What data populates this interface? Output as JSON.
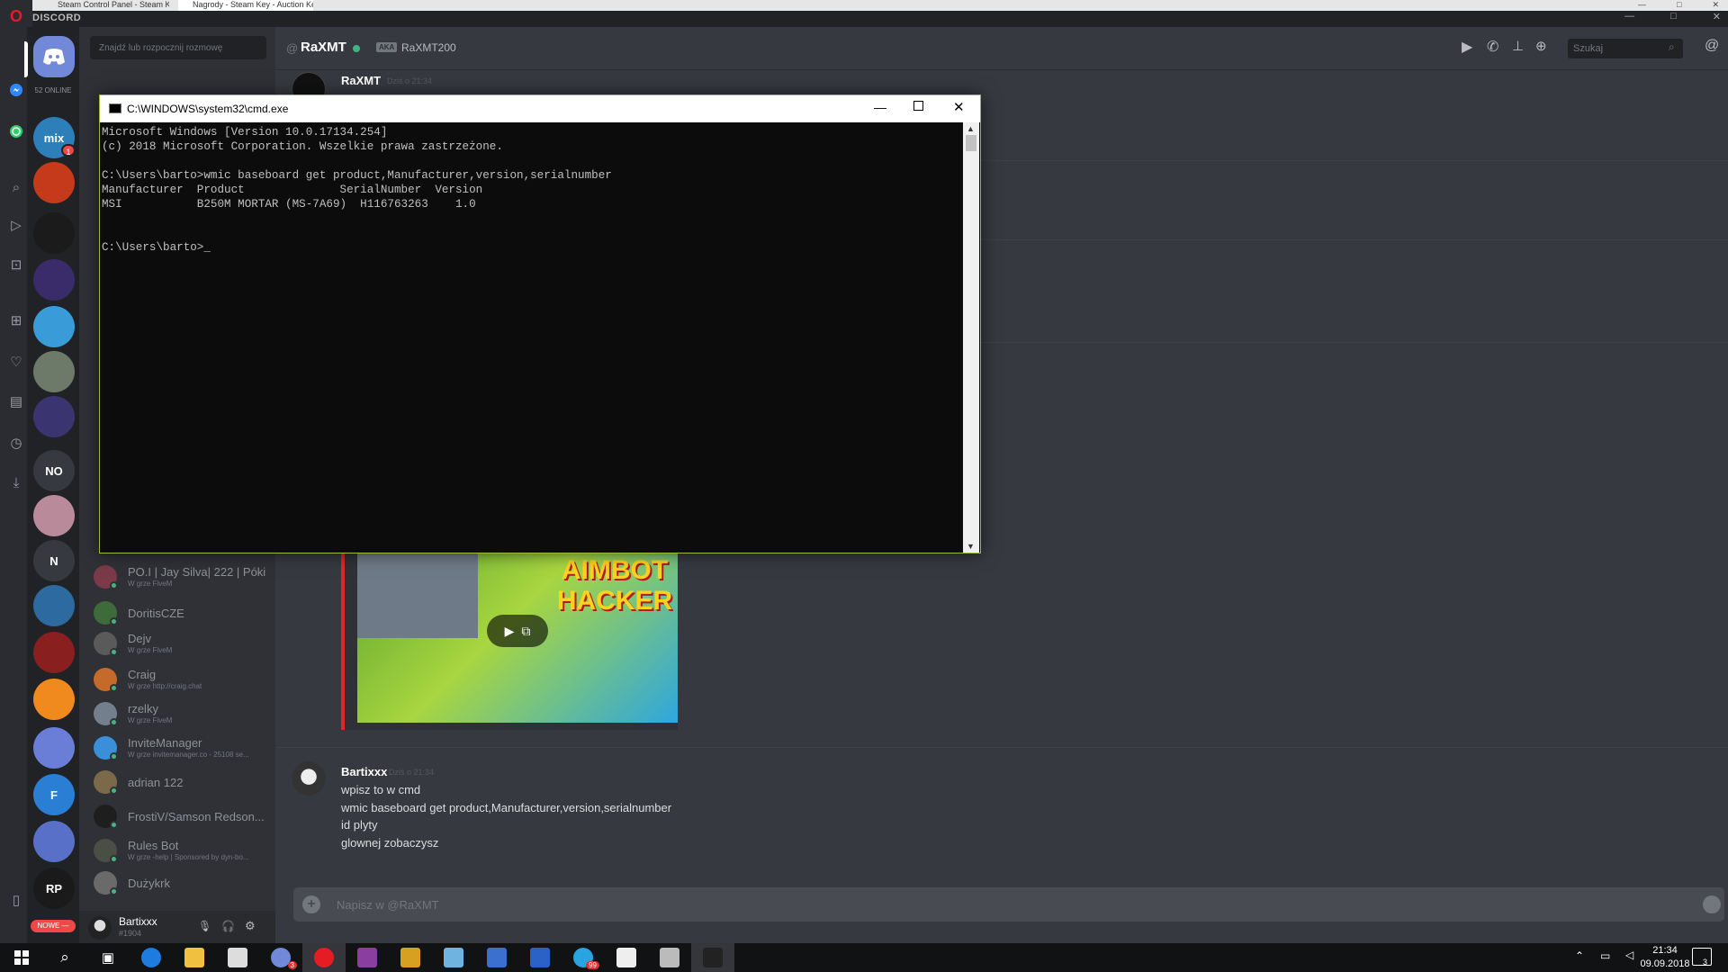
{
  "browser": {
    "tabs": [
      "Steam Control Panel - Steam Key",
      "Nagrody - Steam Key - Auction Ke"
    ],
    "window_controls": [
      "—",
      "□",
      "✕"
    ]
  },
  "discord": {
    "brand": "DISCORD",
    "online_count": "52 ONLINE",
    "window_controls": [
      "—",
      "□",
      "✕"
    ]
  },
  "guilds": [
    {
      "name": "discord-home",
      "label": "",
      "color": "#7289da"
    },
    {
      "name": "mix",
      "label": "mix",
      "color": "#2c7fb8",
      "badge": "1"
    },
    {
      "name": "server-2",
      "label": "",
      "color": "#c43a1a"
    },
    {
      "name": "server-3",
      "label": "",
      "color": "#1b1b1b"
    },
    {
      "name": "server-4",
      "label": "",
      "color": "#3a2b6b"
    },
    {
      "name": "server-5",
      "label": "",
      "color": "#3a9bd9"
    },
    {
      "name": "server-6",
      "label": "",
      "color": "#6d7a6a"
    },
    {
      "name": "server-7",
      "label": "",
      "color": "#3a3570"
    },
    {
      "name": "server-no",
      "label": "NO",
      "color": "#36393f"
    },
    {
      "name": "server-9",
      "label": "",
      "color": "#b88a9a"
    },
    {
      "name": "server-n",
      "label": "N",
      "color": "#36393f"
    },
    {
      "name": "server-11",
      "label": "",
      "color": "#2c6aa0"
    },
    {
      "name": "server-12",
      "label": "",
      "color": "#8a1f1f"
    },
    {
      "name": "server-13",
      "label": "",
      "color": "#f08a1e"
    },
    {
      "name": "server-14",
      "label": "",
      "color": "#6a7ed8"
    },
    {
      "name": "server-15",
      "label": "F",
      "color": "#2a7fd4"
    },
    {
      "name": "server-16",
      "label": "",
      "color": "#5870c8"
    },
    {
      "name": "server-17",
      "label": "RP",
      "color": "#1a1a1a"
    }
  ],
  "new_badge": "NOWE —",
  "dm_search": {
    "placeholder": "Znajdź lub rozpocznij rozmowę"
  },
  "dms": [
    {
      "name": "PO.I | Jay Silva| 222 | Póki",
      "sub": "W grze FiveM",
      "color": "#7a3a4a"
    },
    {
      "name": "DoritisCZE",
      "sub": "",
      "color": "#3f6b3a"
    },
    {
      "name": "Dejv",
      "sub": "W grze FiveM",
      "color": "#5a5a5a"
    },
    {
      "name": "Craig",
      "sub": "W grze http://craig.chat",
      "color": "#c46a2a"
    },
    {
      "name": "rzelky",
      "sub": "W grze FiveM",
      "color": "#747f8d"
    },
    {
      "name": "InviteManager",
      "sub": "W grze invitemanager.co - 25108 se...",
      "color": "#3b8fd8"
    },
    {
      "name": "adrian 122",
      "sub": "",
      "color": "#7a6a4a"
    },
    {
      "name": "FrostiV/Samson Redson...",
      "sub": "",
      "color": "#1e1e1e"
    },
    {
      "name": "Rules Bot",
      "sub": "W grze -help | Sponsored by dyn-bo...",
      "color": "#4a4f45"
    },
    {
      "name": "Dużykrk",
      "sub": "",
      "color": "#6a6a6a"
    }
  ],
  "user_panel": {
    "name": "Bartixxx",
    "tag": "#1904"
  },
  "chat": {
    "recipient": "RaXMT",
    "aka_label": "AKA",
    "aka_name": "RaXMT200",
    "search_placeholder": "Szukaj",
    "composer_placeholder": "Napisz w @RaXMT"
  },
  "messages": [
    {
      "author": "RaXMT",
      "time": "Dziś o 21:34",
      "lines": []
    },
    {
      "author": "Bartixxx",
      "time": "Dziś o 21:34",
      "lines": [
        "wpisz to w cmd",
        "wmic baseboard get product,Manufacturer,version,serialnumber",
        "id plyty",
        "glownej zobaczysz"
      ]
    }
  ],
  "embed": {
    "overlay_text": "AIMBOT HACKER"
  },
  "cmd": {
    "title": "C:\\WINDOWS\\system32\\cmd.exe",
    "lines": [
      "Microsoft Windows [Version 10.0.17134.254]",
      "(c) 2018 Microsoft Corporation. Wszelkie prawa zastrzeżone.",
      "",
      "C:\\Users\\barto>wmic baseboard get product,Manufacturer,version,serialnumber",
      "Manufacturer  Product              SerialNumber  Version",
      "MSI           B250M MORTAR (MS-7A69)  H116763263    1.0",
      "",
      "",
      "C:\\Users\\barto>_"
    ]
  },
  "taskbar": {
    "time": "21:34",
    "date": "09.09.2018",
    "notification_count": "3",
    "app_badges": {
      "discord": "3",
      "telegram": "99"
    }
  }
}
